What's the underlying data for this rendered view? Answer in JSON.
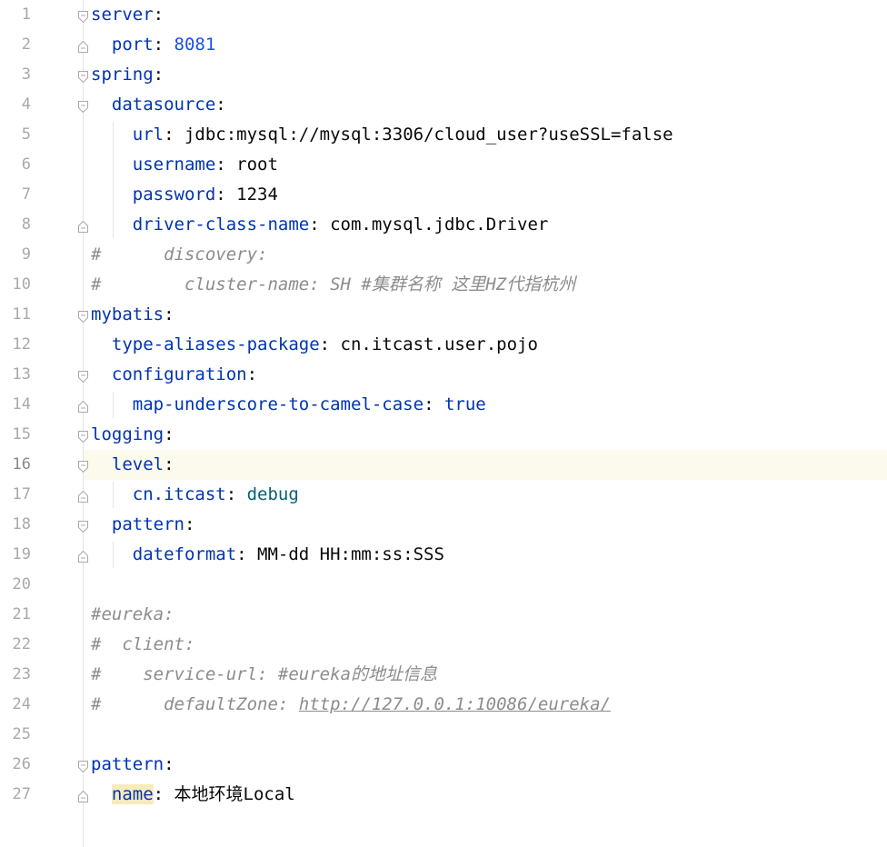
{
  "editor": {
    "current_line": 16,
    "line_numbers": [
      "1",
      "2",
      "3",
      "4",
      "5",
      "6",
      "7",
      "8",
      "9",
      "10",
      "11",
      "12",
      "13",
      "14",
      "15",
      "16",
      "17",
      "18",
      "19",
      "20",
      "21",
      "22",
      "23",
      "24",
      "25",
      "26",
      "27"
    ],
    "lines": [
      [
        {
          "t": "server",
          "c": "key"
        },
        {
          "t": ":",
          "c": "plain"
        }
      ],
      [
        {
          "t": "  "
        },
        {
          "t": "port",
          "c": "key"
        },
        {
          "t": ": ",
          "c": "plain"
        },
        {
          "t": "8081",
          "c": "num"
        }
      ],
      [
        {
          "t": "spring",
          "c": "key"
        },
        {
          "t": ":",
          "c": "plain"
        }
      ],
      [
        {
          "t": "  "
        },
        {
          "t": "datasource",
          "c": "key"
        },
        {
          "t": ":",
          "c": "plain"
        }
      ],
      [
        {
          "t": "    "
        },
        {
          "t": "url",
          "c": "key"
        },
        {
          "t": ": jdbc:mysql://mysql:3306/cloud_user?useSSL=false",
          "c": "plain"
        }
      ],
      [
        {
          "t": "    "
        },
        {
          "t": "username",
          "c": "key"
        },
        {
          "t": ": root",
          "c": "plain"
        }
      ],
      [
        {
          "t": "    "
        },
        {
          "t": "password",
          "c": "key"
        },
        {
          "t": ": 1234",
          "c": "plain"
        }
      ],
      [
        {
          "t": "    "
        },
        {
          "t": "driver-class-name",
          "c": "key"
        },
        {
          "t": ": com.mysql.jdbc.Driver",
          "c": "plain"
        }
      ],
      [
        {
          "t": "#      discovery:",
          "c": "comment"
        }
      ],
      [
        {
          "t": "#        cluster-name: SH #",
          "c": "comment"
        },
        {
          "t": "集群名称 这里",
          "c": "comment cjk"
        },
        {
          "t": "HZ",
          "c": "comment"
        },
        {
          "t": "代指杭州",
          "c": "comment cjk"
        }
      ],
      [
        {
          "t": "mybatis",
          "c": "key"
        },
        {
          "t": ":",
          "c": "plain"
        }
      ],
      [
        {
          "t": "  "
        },
        {
          "t": "type-aliases-package",
          "c": "key"
        },
        {
          "t": ": cn.itcast.user.pojo",
          "c": "plain"
        }
      ],
      [
        {
          "t": "  "
        },
        {
          "t": "configuration",
          "c": "key"
        },
        {
          "t": ":",
          "c": "plain"
        }
      ],
      [
        {
          "t": "    "
        },
        {
          "t": "map-underscore-to-camel-case",
          "c": "key"
        },
        {
          "t": ": ",
          "c": "plain"
        },
        {
          "t": "true",
          "c": "kw"
        }
      ],
      [
        {
          "t": "logging",
          "c": "key"
        },
        {
          "t": ":",
          "c": "plain"
        }
      ],
      [
        {
          "t": "  "
        },
        {
          "t": "level",
          "c": "key"
        },
        {
          "t": ":",
          "c": "plain"
        }
      ],
      [
        {
          "t": "    "
        },
        {
          "t": "cn.itcast",
          "c": "key"
        },
        {
          "t": ": ",
          "c": "plain"
        },
        {
          "t": "debug",
          "c": "enum"
        }
      ],
      [
        {
          "t": "  "
        },
        {
          "t": "pattern",
          "c": "key"
        },
        {
          "t": ":",
          "c": "plain"
        }
      ],
      [
        {
          "t": "    "
        },
        {
          "t": "dateformat",
          "c": "key"
        },
        {
          "t": ": MM-dd HH:mm:ss:SSS",
          "c": "plain"
        }
      ],
      [],
      [
        {
          "t": "#eureka:",
          "c": "comment"
        }
      ],
      [
        {
          "t": "#  client:",
          "c": "comment"
        }
      ],
      [
        {
          "t": "#    service-url: #eureka",
          "c": "comment"
        },
        {
          "t": "的地址信息",
          "c": "comment cjk"
        }
      ],
      [
        {
          "t": "#      defaultZone: ",
          "c": "comment"
        },
        {
          "t": "http://127.0.0.1:10086/eureka/",
          "c": "link"
        }
      ],
      [],
      [
        {
          "t": "pattern",
          "c": "key"
        },
        {
          "t": ":",
          "c": "plain"
        }
      ],
      [
        {
          "t": "  "
        },
        {
          "t": "name",
          "c": "key hl-key"
        },
        {
          "t": ": 本地环境Local",
          "c": "plain"
        }
      ]
    ]
  }
}
